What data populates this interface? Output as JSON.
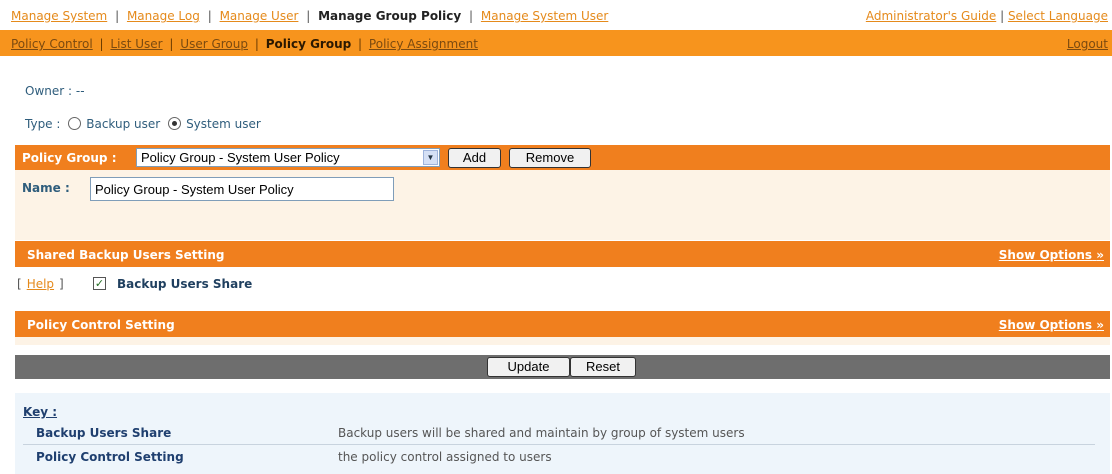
{
  "top_nav": {
    "items": [
      "Manage System",
      "Manage Log",
      "Manage User",
      "Manage Group Policy",
      "Manage System User"
    ],
    "active": "Manage Group Policy",
    "right_links": [
      "Administrator's Guide",
      "Select Language"
    ]
  },
  "sub_nav": {
    "items": [
      "Policy Control",
      "List User",
      "User Group",
      "Policy Group",
      "Policy Assignment"
    ],
    "active": "Policy Group",
    "logout": "Logout"
  },
  "owner": {
    "label": "Owner :",
    "value": "--"
  },
  "type": {
    "label": "Type :",
    "options": [
      "Backup user",
      "System user"
    ],
    "selected": "System user"
  },
  "policy_group": {
    "label": "Policy Group :",
    "selected": "Policy Group - System User Policy",
    "add_label": "Add",
    "remove_label": "Remove"
  },
  "name": {
    "label": "Name :",
    "value": "Policy Group - System User Policy"
  },
  "shared_section": {
    "title": "Shared Backup Users Setting",
    "show_options": "Show Options",
    "help": "Help",
    "checkbox_label": "Backup Users Share",
    "checked": true
  },
  "policy_section": {
    "title": "Policy Control Setting",
    "show_options": "Show Options"
  },
  "actions": {
    "update": "Update",
    "reset": "Reset"
  },
  "key": {
    "title": "Key :",
    "rows": [
      {
        "term": "Backup Users Share",
        "desc": "Backup users will be shared and maintain by group of system users"
      },
      {
        "term": "Policy Control Setting",
        "desc": "the policy control assigned to users"
      }
    ]
  },
  "colors": {
    "orange": "#f07f1e",
    "nav_orange": "#f7941d",
    "dark_gray": "#6e6e6e",
    "light_panel": "#fdf3e6",
    "key_bg": "#eef5fb"
  }
}
